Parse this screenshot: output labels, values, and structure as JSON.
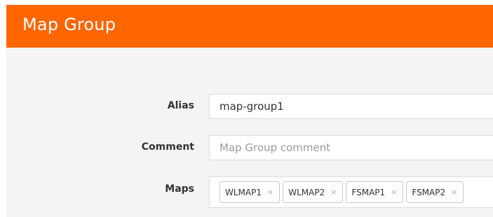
{
  "panel": {
    "title": "Map Group",
    "accent_color": "#ff6600"
  },
  "form": {
    "alias": {
      "label": "Alias",
      "value": "map-group1"
    },
    "comment": {
      "label": "Comment",
      "value": "",
      "placeholder": "Map Group comment"
    },
    "maps": {
      "label": "Maps",
      "remove_glyph": "×",
      "remove_icon": "close-icon",
      "tags": [
        {
          "label": "WLMAP1"
        },
        {
          "label": "WLMAP2"
        },
        {
          "label": "FSMAP1"
        },
        {
          "label": "FSMAP2"
        }
      ]
    }
  }
}
